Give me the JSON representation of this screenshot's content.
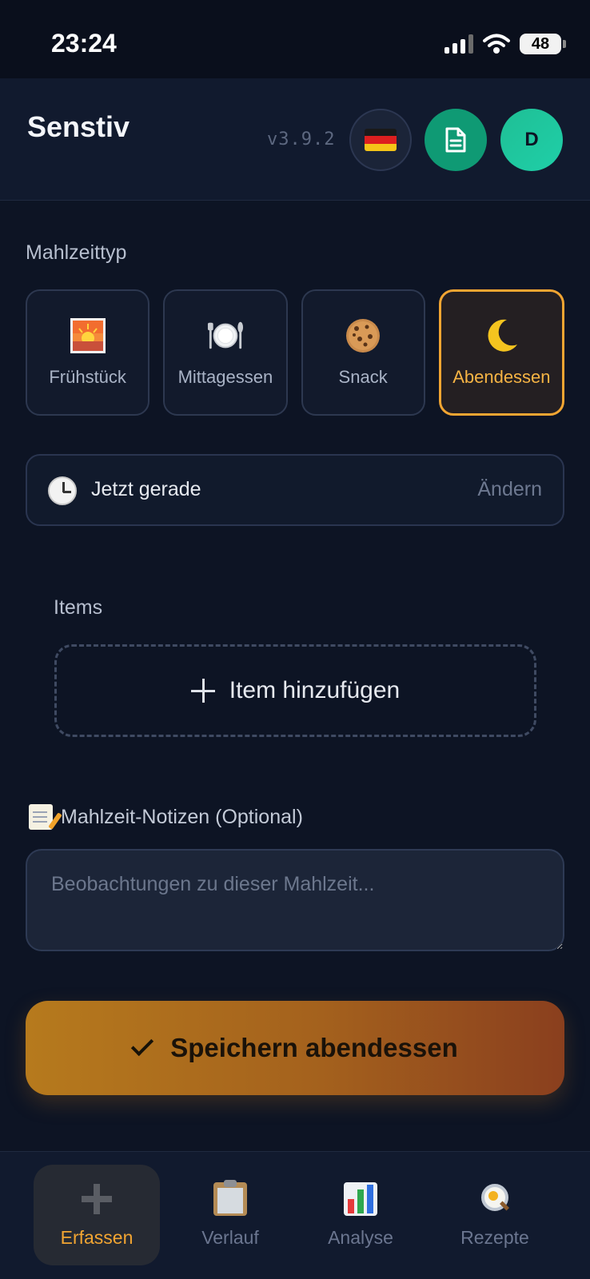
{
  "status_bar": {
    "time": "23:24",
    "battery": "48"
  },
  "header": {
    "title": "Senstiv",
    "version": "v3.9.2",
    "avatar_initial": "D"
  },
  "meal_type": {
    "label": "Mahlzeittyp",
    "options": [
      {
        "label": "Frühstück",
        "icon": "sunrise-icon"
      },
      {
        "label": "Mittagessen",
        "icon": "plate-cutlery-icon"
      },
      {
        "label": "Snack",
        "icon": "cookie-icon"
      },
      {
        "label": "Abendessen",
        "icon": "moon-icon",
        "selected": true
      }
    ]
  },
  "time": {
    "label": "Jetzt gerade",
    "action": "Ändern"
  },
  "items": {
    "label": "Items",
    "add_label": "Item hinzufügen"
  },
  "notes": {
    "label": "Mahlzeit-Notizen (Optional)",
    "placeholder": "Beobachtungen zu dieser Mahlzeit..."
  },
  "save": {
    "label": "Speichern abendessen"
  },
  "bottom_nav": [
    {
      "label": "Erfassen",
      "active": true
    },
    {
      "label": "Verlauf"
    },
    {
      "label": "Analyse"
    },
    {
      "label": "Rezepte"
    }
  ],
  "colors": {
    "accent": "#f2a532",
    "background": "#0d1424",
    "doc_button": "#0f9a74",
    "avatar": "#1fcfa8"
  }
}
